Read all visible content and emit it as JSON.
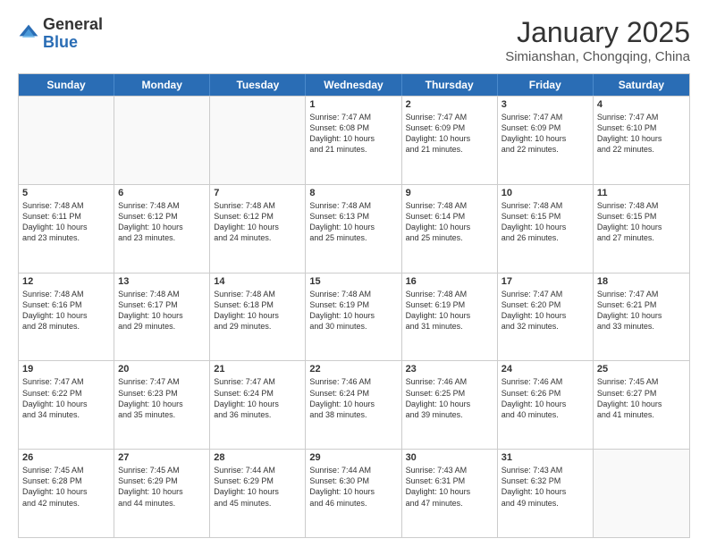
{
  "header": {
    "logo_general": "General",
    "logo_blue": "Blue",
    "month_title": "January 2025",
    "subtitle": "Simianshan, Chongqing, China"
  },
  "days_of_week": [
    "Sunday",
    "Monday",
    "Tuesday",
    "Wednesday",
    "Thursday",
    "Friday",
    "Saturday"
  ],
  "weeks": [
    [
      {
        "day": "",
        "info": ""
      },
      {
        "day": "",
        "info": ""
      },
      {
        "day": "",
        "info": ""
      },
      {
        "day": "1",
        "info": "Sunrise: 7:47 AM\nSunset: 6:08 PM\nDaylight: 10 hours\nand 21 minutes."
      },
      {
        "day": "2",
        "info": "Sunrise: 7:47 AM\nSunset: 6:09 PM\nDaylight: 10 hours\nand 21 minutes."
      },
      {
        "day": "3",
        "info": "Sunrise: 7:47 AM\nSunset: 6:09 PM\nDaylight: 10 hours\nand 22 minutes."
      },
      {
        "day": "4",
        "info": "Sunrise: 7:47 AM\nSunset: 6:10 PM\nDaylight: 10 hours\nand 22 minutes."
      }
    ],
    [
      {
        "day": "5",
        "info": "Sunrise: 7:48 AM\nSunset: 6:11 PM\nDaylight: 10 hours\nand 23 minutes."
      },
      {
        "day": "6",
        "info": "Sunrise: 7:48 AM\nSunset: 6:12 PM\nDaylight: 10 hours\nand 23 minutes."
      },
      {
        "day": "7",
        "info": "Sunrise: 7:48 AM\nSunset: 6:12 PM\nDaylight: 10 hours\nand 24 minutes."
      },
      {
        "day": "8",
        "info": "Sunrise: 7:48 AM\nSunset: 6:13 PM\nDaylight: 10 hours\nand 25 minutes."
      },
      {
        "day": "9",
        "info": "Sunrise: 7:48 AM\nSunset: 6:14 PM\nDaylight: 10 hours\nand 25 minutes."
      },
      {
        "day": "10",
        "info": "Sunrise: 7:48 AM\nSunset: 6:15 PM\nDaylight: 10 hours\nand 26 minutes."
      },
      {
        "day": "11",
        "info": "Sunrise: 7:48 AM\nSunset: 6:15 PM\nDaylight: 10 hours\nand 27 minutes."
      }
    ],
    [
      {
        "day": "12",
        "info": "Sunrise: 7:48 AM\nSunset: 6:16 PM\nDaylight: 10 hours\nand 28 minutes."
      },
      {
        "day": "13",
        "info": "Sunrise: 7:48 AM\nSunset: 6:17 PM\nDaylight: 10 hours\nand 29 minutes."
      },
      {
        "day": "14",
        "info": "Sunrise: 7:48 AM\nSunset: 6:18 PM\nDaylight: 10 hours\nand 29 minutes."
      },
      {
        "day": "15",
        "info": "Sunrise: 7:48 AM\nSunset: 6:19 PM\nDaylight: 10 hours\nand 30 minutes."
      },
      {
        "day": "16",
        "info": "Sunrise: 7:48 AM\nSunset: 6:19 PM\nDaylight: 10 hours\nand 31 minutes."
      },
      {
        "day": "17",
        "info": "Sunrise: 7:47 AM\nSunset: 6:20 PM\nDaylight: 10 hours\nand 32 minutes."
      },
      {
        "day": "18",
        "info": "Sunrise: 7:47 AM\nSunset: 6:21 PM\nDaylight: 10 hours\nand 33 minutes."
      }
    ],
    [
      {
        "day": "19",
        "info": "Sunrise: 7:47 AM\nSunset: 6:22 PM\nDaylight: 10 hours\nand 34 minutes."
      },
      {
        "day": "20",
        "info": "Sunrise: 7:47 AM\nSunset: 6:23 PM\nDaylight: 10 hours\nand 35 minutes."
      },
      {
        "day": "21",
        "info": "Sunrise: 7:47 AM\nSunset: 6:24 PM\nDaylight: 10 hours\nand 36 minutes."
      },
      {
        "day": "22",
        "info": "Sunrise: 7:46 AM\nSunset: 6:24 PM\nDaylight: 10 hours\nand 38 minutes."
      },
      {
        "day": "23",
        "info": "Sunrise: 7:46 AM\nSunset: 6:25 PM\nDaylight: 10 hours\nand 39 minutes."
      },
      {
        "day": "24",
        "info": "Sunrise: 7:46 AM\nSunset: 6:26 PM\nDaylight: 10 hours\nand 40 minutes."
      },
      {
        "day": "25",
        "info": "Sunrise: 7:45 AM\nSunset: 6:27 PM\nDaylight: 10 hours\nand 41 minutes."
      }
    ],
    [
      {
        "day": "26",
        "info": "Sunrise: 7:45 AM\nSunset: 6:28 PM\nDaylight: 10 hours\nand 42 minutes."
      },
      {
        "day": "27",
        "info": "Sunrise: 7:45 AM\nSunset: 6:29 PM\nDaylight: 10 hours\nand 44 minutes."
      },
      {
        "day": "28",
        "info": "Sunrise: 7:44 AM\nSunset: 6:29 PM\nDaylight: 10 hours\nand 45 minutes."
      },
      {
        "day": "29",
        "info": "Sunrise: 7:44 AM\nSunset: 6:30 PM\nDaylight: 10 hours\nand 46 minutes."
      },
      {
        "day": "30",
        "info": "Sunrise: 7:43 AM\nSunset: 6:31 PM\nDaylight: 10 hours\nand 47 minutes."
      },
      {
        "day": "31",
        "info": "Sunrise: 7:43 AM\nSunset: 6:32 PM\nDaylight: 10 hours\nand 49 minutes."
      },
      {
        "day": "",
        "info": ""
      }
    ]
  ]
}
